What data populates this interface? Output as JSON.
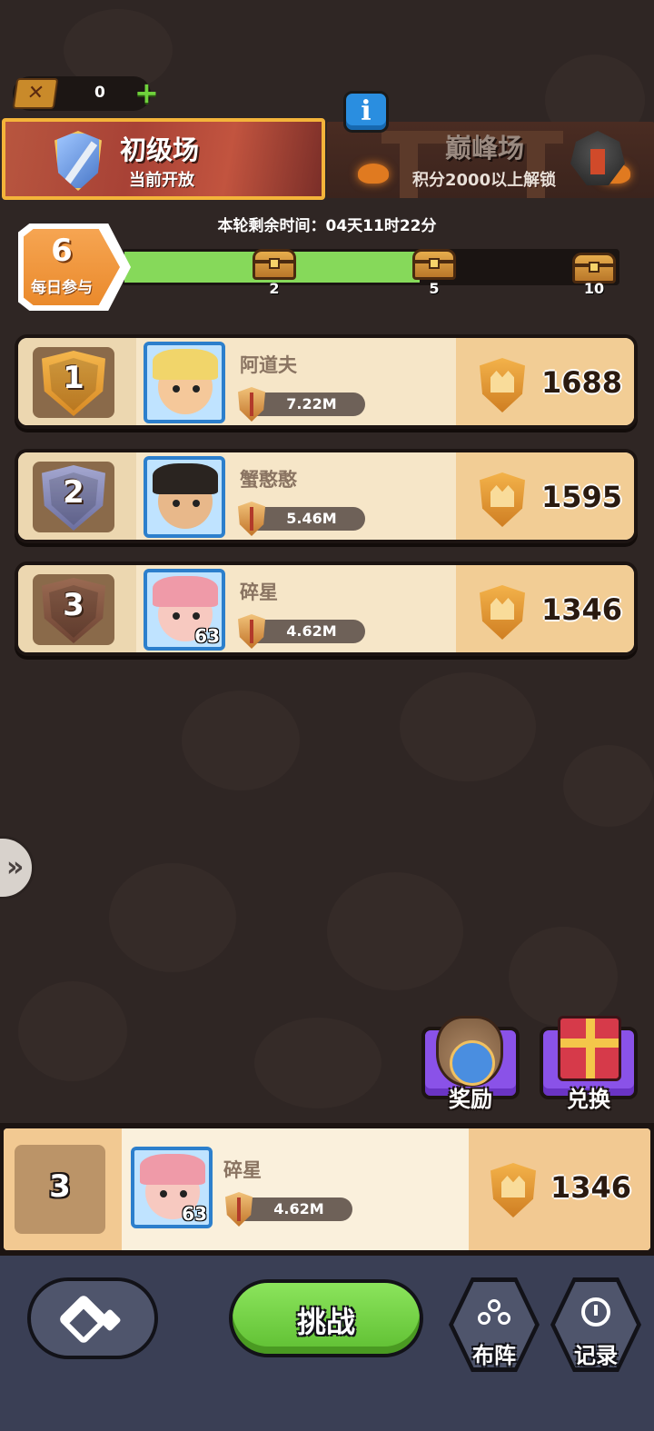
{
  "currency": {
    "ticket_count": "0"
  },
  "tabs": {
    "beginner": {
      "title": "初级场",
      "subtitle": "当前开放"
    },
    "peak": {
      "title": "巅峰场",
      "subtitle": "积分2000以上解锁"
    }
  },
  "remaining_time": "本轮剩余时间：04天11时22分",
  "daily": {
    "count": "6",
    "label": "每日参与"
  },
  "progress": {
    "current": 6,
    "max": 10,
    "chests": [
      {
        "label": "2"
      },
      {
        "label": "5"
      },
      {
        "label": "10"
      }
    ]
  },
  "leaderboard": [
    {
      "rank": "1",
      "name": "阿道夫",
      "power": "7.22M",
      "score": "1688",
      "level": ""
    },
    {
      "rank": "2",
      "name": "蟹憨憨",
      "power": "5.46M",
      "score": "1595",
      "level": ""
    },
    {
      "rank": "3",
      "name": "碎星",
      "power": "4.62M",
      "score": "1346",
      "level": "63"
    }
  ],
  "actions": {
    "reward_label": "奖励",
    "exchange_label": "兑换"
  },
  "my_rank": {
    "rank": "3",
    "name": "碎星",
    "power": "4.62M",
    "score": "1346",
    "level": "63"
  },
  "bottom_nav": {
    "challenge_label": "挑战",
    "formation_label": "布阵",
    "record_label": "记录"
  },
  "colors": {
    "progress_fill": "#86d95a",
    "gold_medal": "#e9a53a",
    "silver_medal": "#8c8fb8",
    "bronze_medal": "#8a5a44",
    "action_purple": "#8a52e8",
    "challenge_green": "#6fcf3f"
  }
}
